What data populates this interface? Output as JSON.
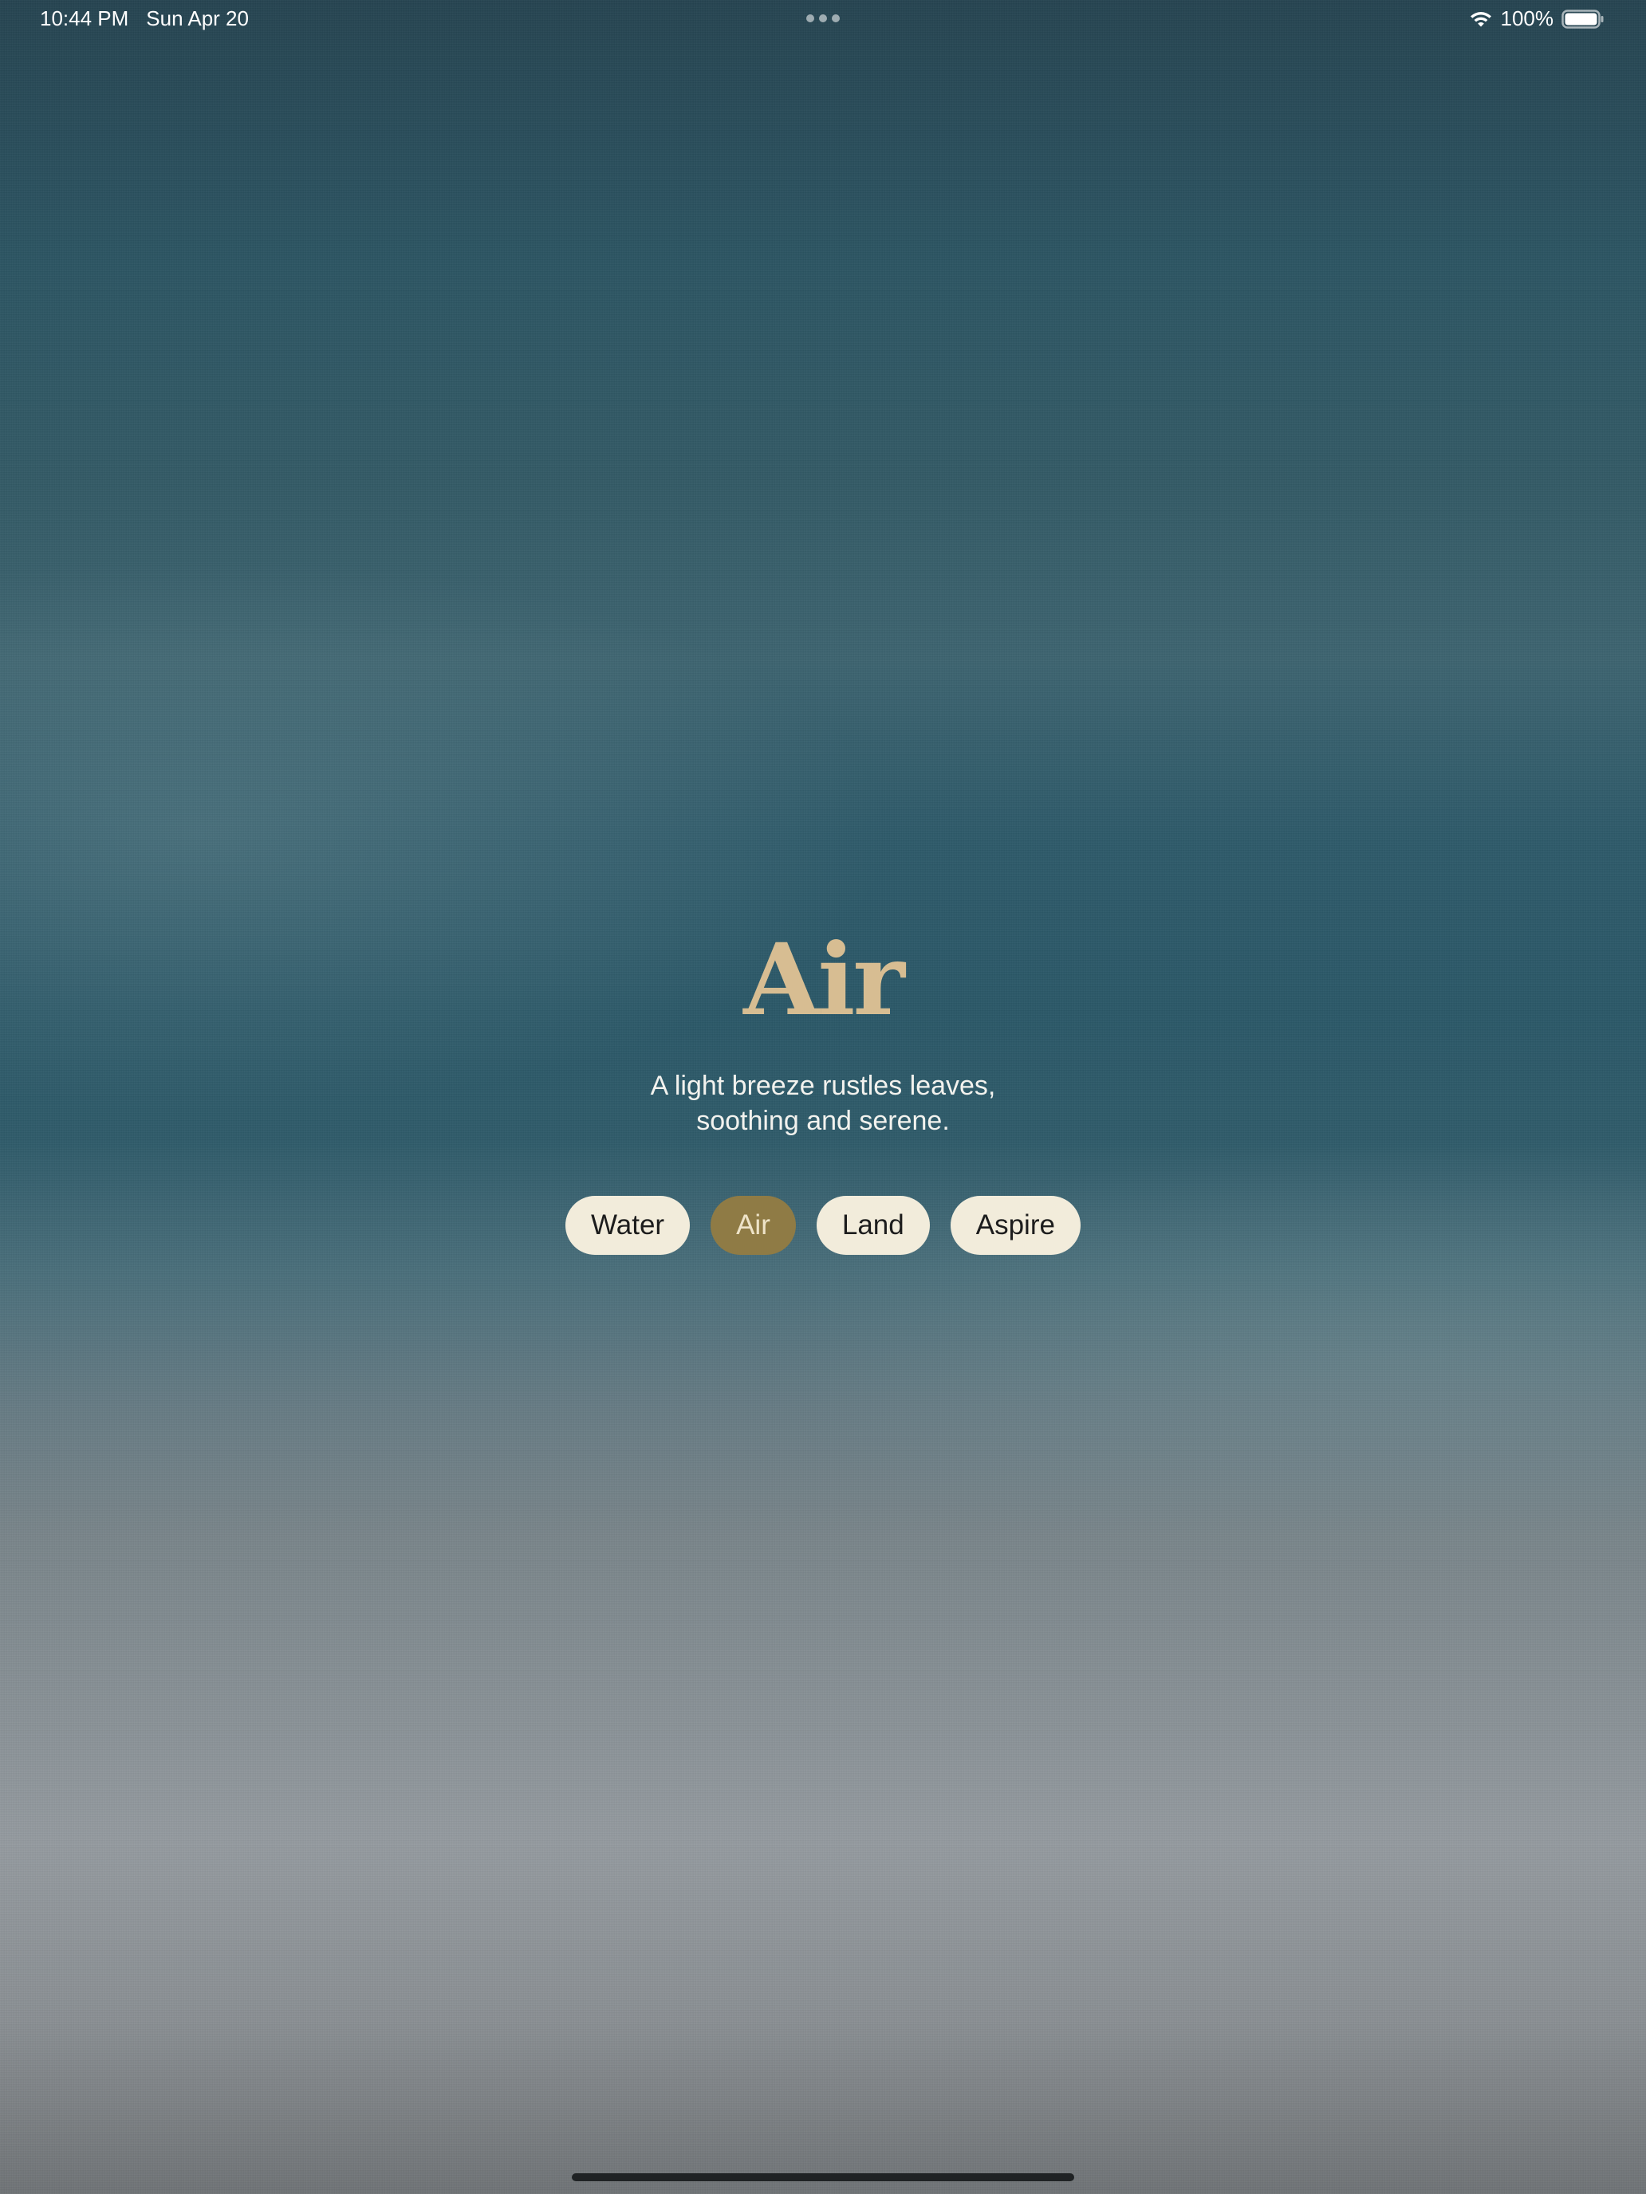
{
  "status_bar": {
    "time": "10:44 PM",
    "date": "Sun Apr 20",
    "battery_percent": "100%",
    "icons": [
      "multitask-dots-icon",
      "wifi-icon",
      "battery-icon"
    ]
  },
  "hero": {
    "title": "Air",
    "subtitle_lines": [
      "A light breeze rustles leaves,",
      "soothing and serene."
    ]
  },
  "pills": [
    {
      "label": "Water",
      "selected": false
    },
    {
      "label": "Air",
      "selected": true
    },
    {
      "label": "Land",
      "selected": false
    },
    {
      "label": "Aspire",
      "selected": false
    }
  ],
  "colors": {
    "title": "#d7bd92",
    "pill_bg": "#f2ecdb",
    "pill_active_bg": "#8f7b45",
    "sky_top": "#264451",
    "sky_bottom": "#6f7376"
  }
}
